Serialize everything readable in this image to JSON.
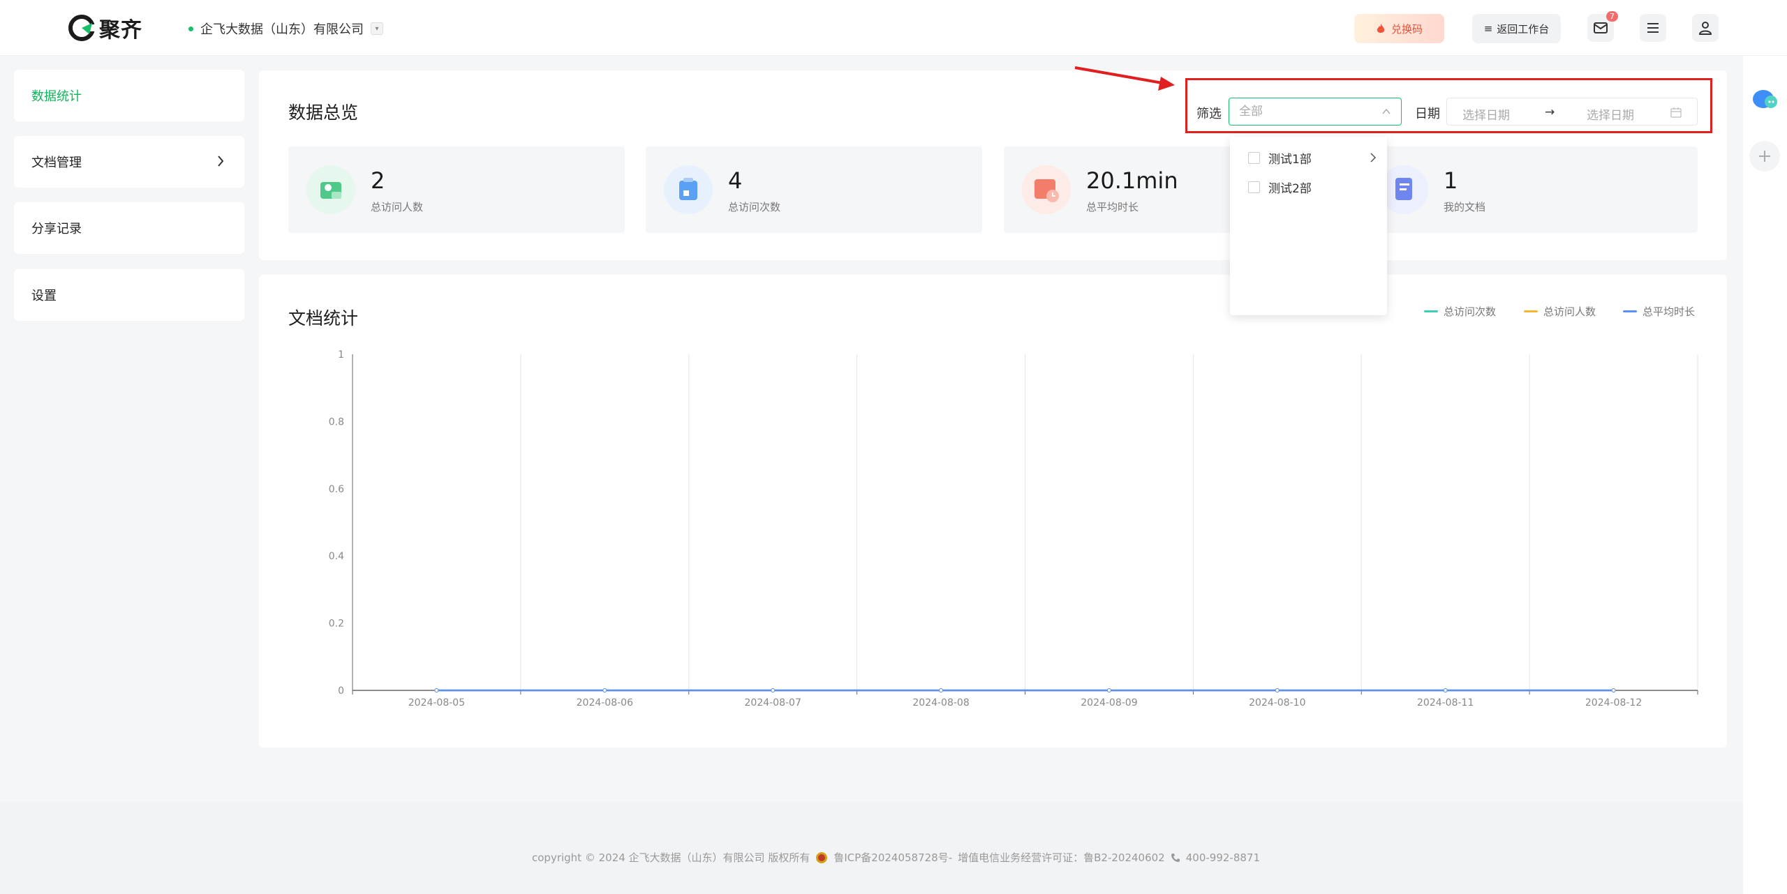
{
  "header": {
    "logo_text": "聚齐",
    "company": "企飞大数据（山东）有限公司",
    "redeem_label": "兑换码",
    "back_label": "返回工作台",
    "mail_badge": "7"
  },
  "sidebar": {
    "items": [
      {
        "label": "数据统计"
      },
      {
        "label": "文档管理"
      },
      {
        "label": "分享记录"
      },
      {
        "label": "设置"
      }
    ]
  },
  "overview": {
    "title": "数据总览",
    "filter_label": "筛选",
    "select_placeholder": "全部",
    "date_label": "日期",
    "date_start_placeholder": "选择日期",
    "date_separator": "→",
    "date_end_placeholder": "选择日期",
    "dropdown_options": [
      {
        "label": "测试1部",
        "has_children": true
      },
      {
        "label": "测试2部",
        "has_children": false
      }
    ],
    "stats": [
      {
        "value": "2",
        "label": "总访问人数",
        "color": "#4fc98a"
      },
      {
        "value": "4",
        "label": "总访问次数",
        "color": "#5aa0f5"
      },
      {
        "value": "20.1min",
        "label": "总平均时长",
        "color": "#f27d6a"
      },
      {
        "value": "1",
        "label": "我的文档",
        "color": "#6f86f0"
      }
    ]
  },
  "doc_stats": {
    "title": "文档统计",
    "legend": [
      {
        "label": "总访问次数",
        "color": "#3ccfb4"
      },
      {
        "label": "总访问人数",
        "color": "#f5b731"
      },
      {
        "label": "总平均时长",
        "color": "#5b8ff9"
      }
    ]
  },
  "chart_data": {
    "type": "line",
    "x": [
      "2024-08-05",
      "2024-08-06",
      "2024-08-07",
      "2024-08-08",
      "2024-08-09",
      "2024-08-10",
      "2024-08-11",
      "2024-08-12"
    ],
    "yticks": [
      "0",
      "0.2",
      "0.4",
      "0.6",
      "0.8",
      "1"
    ],
    "ylim": [
      0,
      1
    ],
    "grid": true,
    "legend_position": "top-right",
    "series": [
      {
        "name": "总访问次数",
        "values": [
          0,
          0,
          0,
          0,
          0,
          0,
          0,
          0
        ],
        "color": "#3ccfb4"
      },
      {
        "name": "总访问人数",
        "values": [
          0,
          0,
          0,
          0,
          0,
          0,
          0,
          0
        ],
        "color": "#f5b731"
      },
      {
        "name": "总平均时长",
        "values": [
          0,
          0,
          0,
          0,
          0,
          0,
          0,
          0
        ],
        "color": "#5b8ff9"
      }
    ]
  },
  "footer": {
    "copyright": "copyright © 2024 企飞大数据（山东）有限公司 版权所有",
    "icp": "鲁ICP备2024058728号-",
    "license": "增值电信业务经营许可证：鲁B2-20240602",
    "phone": "400-992-8871"
  }
}
